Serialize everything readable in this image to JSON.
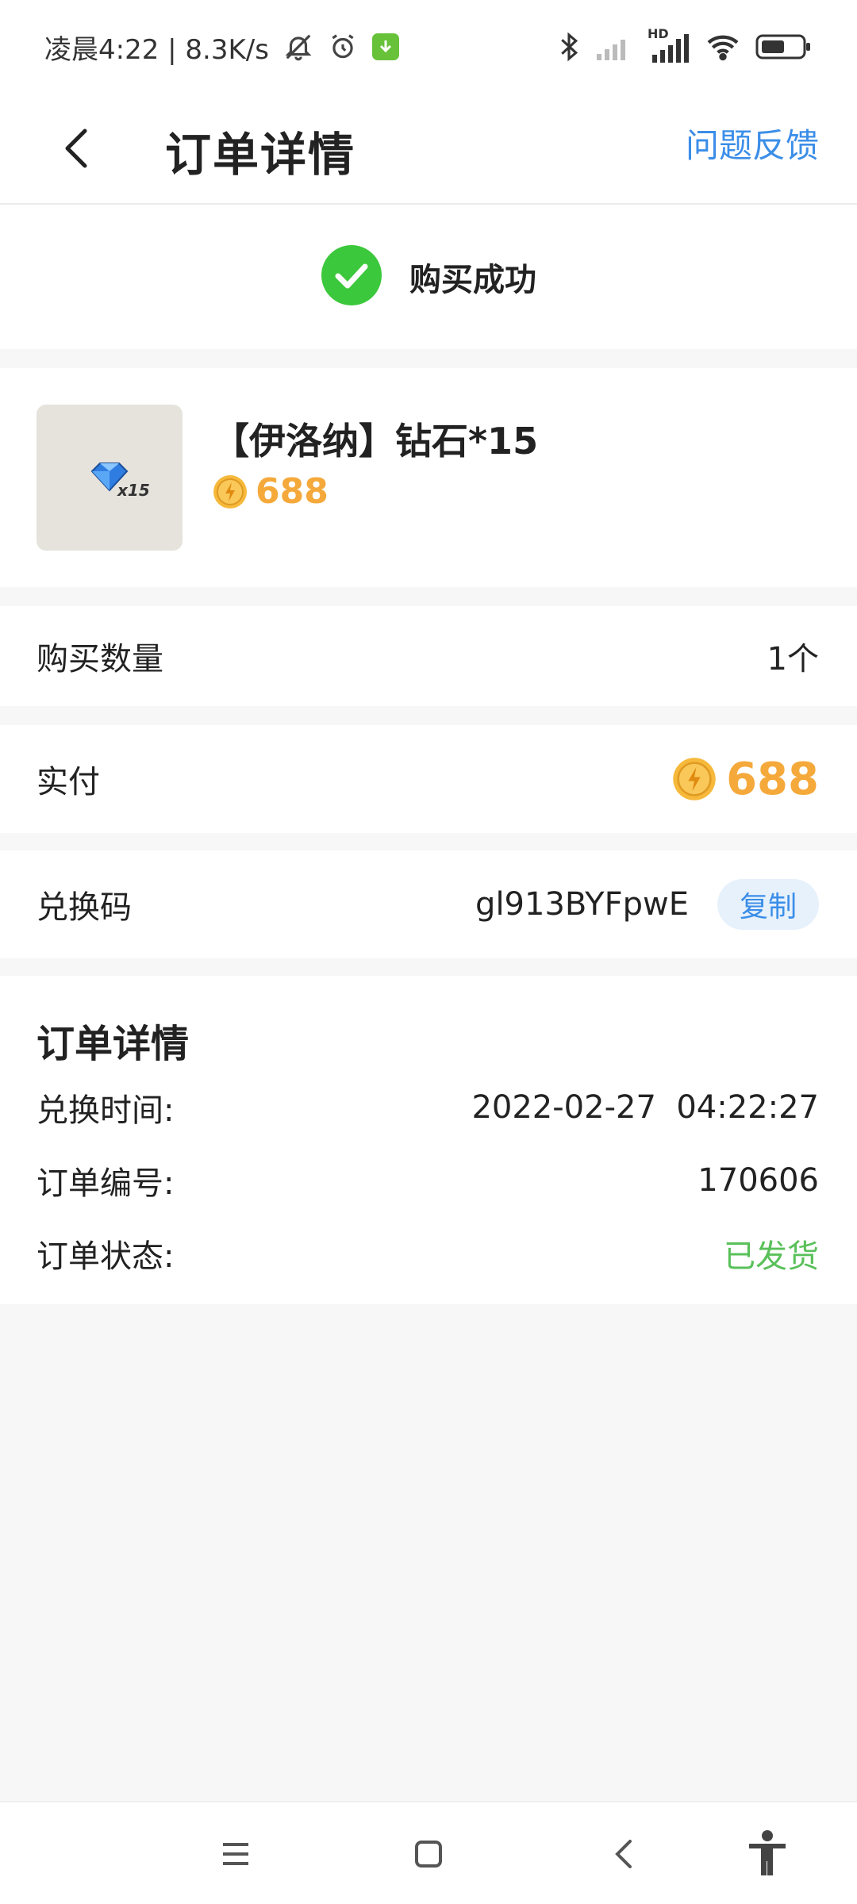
{
  "status_bar": {
    "left_text": "凌晨4:22 | 8.3K/s",
    "hd_label": "HD",
    "colors": {
      "download_badge": "#67c23a"
    }
  },
  "header": {
    "title": "订单详情",
    "feedback_label": "问题反馈"
  },
  "success": {
    "text": "购买成功",
    "icon_color": "#3cc83c"
  },
  "product": {
    "name": "【伊洛纳】钻石*15",
    "price": "688",
    "thumb_badge": "x15"
  },
  "quantity_row": {
    "label": "购买数量",
    "value": "1个"
  },
  "payment_row": {
    "label": "实付",
    "amount": "688"
  },
  "code_row": {
    "label": "兑换码",
    "value": "gl913BYFpwE",
    "copy_label": "复制"
  },
  "order_details": {
    "title": "订单详情",
    "rows": [
      {
        "label": "兑换时间:",
        "value": "2022-02-27  04:22:27"
      },
      {
        "label": "订单编号:",
        "value": "170606"
      },
      {
        "label": "订单状态:",
        "value": "已发货"
      }
    ]
  },
  "colors": {
    "accent_blue": "#3b8ee8",
    "price_orange": "#f5a93b",
    "status_green": "#5ac05a"
  }
}
